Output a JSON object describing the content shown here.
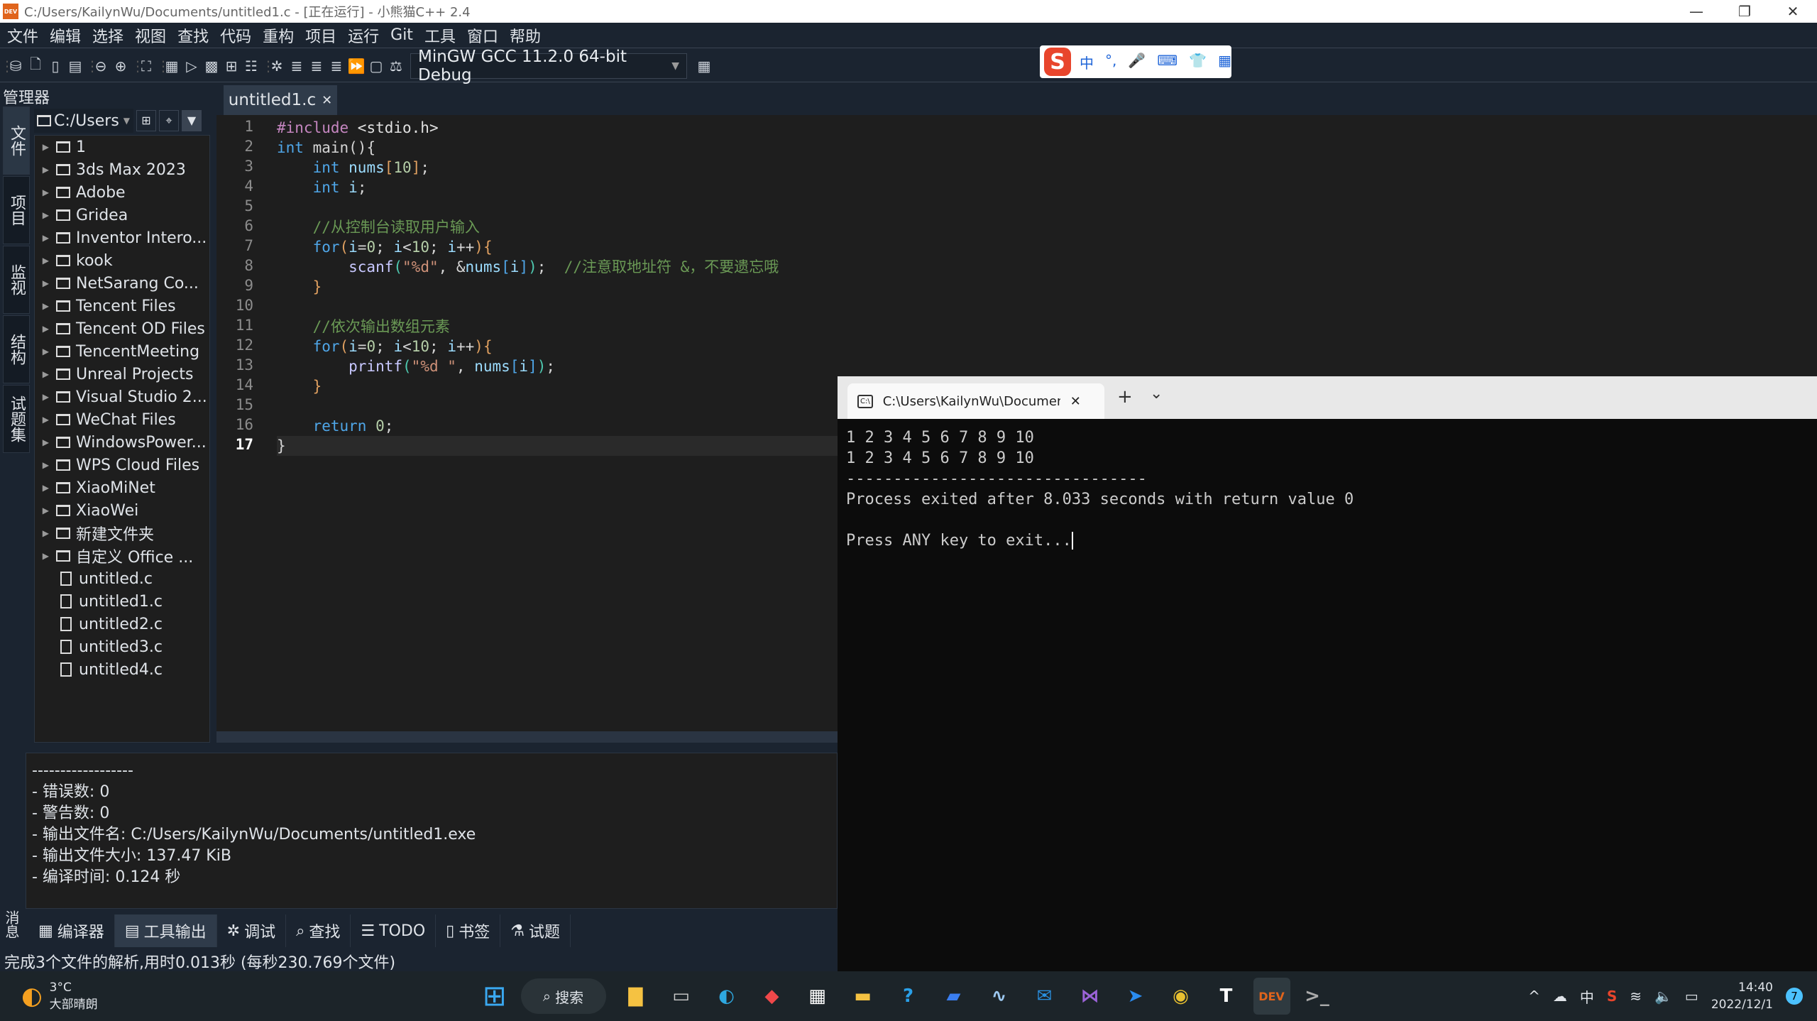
{
  "window": {
    "title": "C:/Users/KailynWu/Documents/untitled1.c - [正在运行] - 小熊猫C++ 2.4",
    "logo": "DEV",
    "minimize": "—",
    "maximize": "❐",
    "close": "✕"
  },
  "menu": [
    "文件",
    "编辑",
    "选择",
    "视图",
    "查找",
    "代码",
    "重构",
    "项目",
    "运行",
    "Git",
    "工具",
    "窗口",
    "帮助"
  ],
  "toolbar": {
    "compiler": "MinGW GCC 11.2.0 64-bit Debug"
  },
  "ime": {
    "logo": "S",
    "items": [
      "中",
      "°,",
      "🎤",
      "⌨",
      "👕",
      "▦"
    ]
  },
  "manager": {
    "title": "管理器",
    "side_tabs": [
      "文件",
      "项目",
      "监视",
      "结构",
      "试题集"
    ],
    "path": "C:/Users",
    "folders": [
      "1",
      "3ds Max 2023",
      "Adobe",
      "Gridea",
      "Inventor Intero...",
      "kook",
      "NetSarang Co...",
      "Tencent Files",
      "Tencent OD Files",
      "TencentMeeting",
      "Unreal Projects",
      "Visual Studio 2...",
      "WeChat Files",
      "WindowsPower...",
      "WPS Cloud Files",
      "XiaoMiNet",
      "XiaoWei",
      "新建文件夹",
      "自定义 Office ..."
    ],
    "files": [
      "untitled.c",
      "untitled1.c",
      "untitled2.c",
      "untitled3.c",
      "untitled4.c"
    ]
  },
  "editor": {
    "tab": "untitled1.c",
    "tab_close": "✕",
    "current_line": 17,
    "lines": [
      [
        [
          "#include",
          "pp"
        ],
        [
          " <stdio.h>",
          "hd"
        ]
      ],
      [
        [
          "int",
          "kw"
        ],
        [
          " main",
          "plain"
        ],
        [
          "()",
          "plain"
        ],
        [
          "{",
          "plain"
        ]
      ],
      [
        [
          "    int",
          "kw"
        ],
        [
          " nums",
          "id"
        ],
        [
          "[",
          "br1"
        ],
        [
          "10",
          "num"
        ],
        [
          "]",
          "br1"
        ],
        [
          ";",
          "plain"
        ]
      ],
      [
        [
          "    int",
          "kw"
        ],
        [
          " i",
          "id"
        ],
        [
          ";",
          "plain"
        ]
      ],
      [],
      [
        [
          "    //从控制台读取用户输入",
          "cm"
        ]
      ],
      [
        [
          "    for",
          "kw"
        ],
        [
          "(",
          "br1"
        ],
        [
          "i",
          "id"
        ],
        [
          "=",
          "plain"
        ],
        [
          "0",
          "num"
        ],
        [
          "; ",
          "plain"
        ],
        [
          "i",
          "id"
        ],
        [
          "<",
          "plain"
        ],
        [
          "10",
          "num"
        ],
        [
          "; ",
          "plain"
        ],
        [
          "i",
          "id"
        ],
        [
          "++",
          "plain"
        ],
        [
          ")",
          "br1"
        ],
        [
          "{",
          "br1"
        ]
      ],
      [
        [
          "        scanf",
          "fn"
        ],
        [
          "(",
          "br3"
        ],
        [
          "\"%d\"",
          "str"
        ],
        [
          ", &",
          "plain"
        ],
        [
          "nums",
          "id"
        ],
        [
          "[",
          "br2"
        ],
        [
          "i",
          "id"
        ],
        [
          "]",
          "br2"
        ],
        [
          ")",
          "br3"
        ],
        [
          ";  ",
          "plain"
        ],
        [
          "//注意取地址符 &，不要遗忘哦",
          "cm"
        ]
      ],
      [
        [
          "    }",
          "br1"
        ]
      ],
      [],
      [
        [
          "    //依次输出数组元素",
          "cm"
        ]
      ],
      [
        [
          "    for",
          "kw"
        ],
        [
          "(",
          "br1"
        ],
        [
          "i",
          "id"
        ],
        [
          "=",
          "plain"
        ],
        [
          "0",
          "num"
        ],
        [
          "; ",
          "plain"
        ],
        [
          "i",
          "id"
        ],
        [
          "<",
          "plain"
        ],
        [
          "10",
          "num"
        ],
        [
          "; ",
          "plain"
        ],
        [
          "i",
          "id"
        ],
        [
          "++",
          "plain"
        ],
        [
          ")",
          "br1"
        ],
        [
          "{",
          "br1"
        ]
      ],
      [
        [
          "        printf",
          "fn"
        ],
        [
          "(",
          "br3"
        ],
        [
          "\"%d \"",
          "str"
        ],
        [
          ", ",
          "plain"
        ],
        [
          "nums",
          "id"
        ],
        [
          "[",
          "br2"
        ],
        [
          "i",
          "id"
        ],
        [
          "]",
          "br2"
        ],
        [
          ")",
          "br3"
        ],
        [
          ";",
          "plain"
        ]
      ],
      [
        [
          "    }",
          "br1"
        ]
      ],
      [],
      [
        [
          "    return",
          "kw"
        ],
        [
          " 0",
          "num"
        ],
        [
          ";",
          "plain"
        ]
      ],
      [
        [
          "}",
          "plain"
        ]
      ]
    ]
  },
  "output": {
    "lines": [
      "------------------",
      "- 错误数: 0",
      "- 警告数: 0",
      "- 输出文件名: C:/Users/KailynWu/Documents/untitled1.exe",
      "- 输出文件大小: 137.47 KiB",
      "- 编译时间: 0.124 秒"
    ]
  },
  "bottom_tabs": [
    {
      "icon": "▦",
      "label": "编译器"
    },
    {
      "icon": "▤",
      "label": "工具输出",
      "active": true
    },
    {
      "icon": "✲",
      "label": "调试"
    },
    {
      "icon": "⌕",
      "label": "查找"
    },
    {
      "icon": "☰",
      "label": "TODO"
    },
    {
      "icon": "▯",
      "label": "书签"
    },
    {
      "icon": "⚗",
      "label": "试题"
    }
  ],
  "messages_label": "消息",
  "status": "完成3个文件的解析,用时0.013秒 (每秒230.769个文件)",
  "terminal": {
    "tab_title": "C:\\Users\\KailynWu\\Document",
    "tab_icon": "C:\\",
    "close": "✕",
    "new_tab": "+",
    "dropdown": "⌄",
    "output": "1 2 3 4 5 6 7 8 9 10\n1 2 3 4 5 6 7 8 9 10\n--------------------------------\nProcess exited after 8.033 seconds with return value 0\n\nPress ANY key to exit..."
  },
  "taskbar": {
    "weather_temp": "3°C",
    "weather_desc": "大部晴朗",
    "search": "搜索",
    "time": "14:40",
    "date": "2022/12/1",
    "notifications": "7",
    "ime_lang": "中",
    "apps": [
      {
        "name": "file-explorer",
        "glyph": "▇",
        "color": "#f5c242"
      },
      {
        "name": "task-view",
        "glyph": "▭",
        "color": "#ccc"
      },
      {
        "name": "edge",
        "glyph": "◐",
        "color": "#2ea8e0"
      },
      {
        "name": "app-red",
        "glyph": "◆",
        "color": "#f0484a"
      },
      {
        "name": "store",
        "glyph": "▦",
        "color": "#fff"
      },
      {
        "name": "folder",
        "glyph": "▬",
        "color": "#f5c242"
      },
      {
        "name": "help",
        "glyph": "?",
        "color": "#2aa0e8"
      },
      {
        "name": "app-blue",
        "glyph": "▰",
        "color": "#3a7ef0"
      },
      {
        "name": "monitor",
        "glyph": "∿",
        "color": "#9cc8f0"
      },
      {
        "name": "mail",
        "glyph": "✉",
        "color": "#2a90e0"
      },
      {
        "name": "visual-studio",
        "glyph": "⋈",
        "color": "#9b63d8"
      },
      {
        "name": "feishu",
        "glyph": "➤",
        "color": "#2a8cf0"
      },
      {
        "name": "chrome",
        "glyph": "◉",
        "color": "#e8c030"
      },
      {
        "name": "typora",
        "glyph": "T",
        "color": "#fff"
      },
      {
        "name": "redpanda-cpp",
        "glyph": "DEV",
        "color": "#e0641c"
      },
      {
        "name": "terminal",
        "glyph": ">_",
        "color": "#aaa"
      }
    ]
  }
}
